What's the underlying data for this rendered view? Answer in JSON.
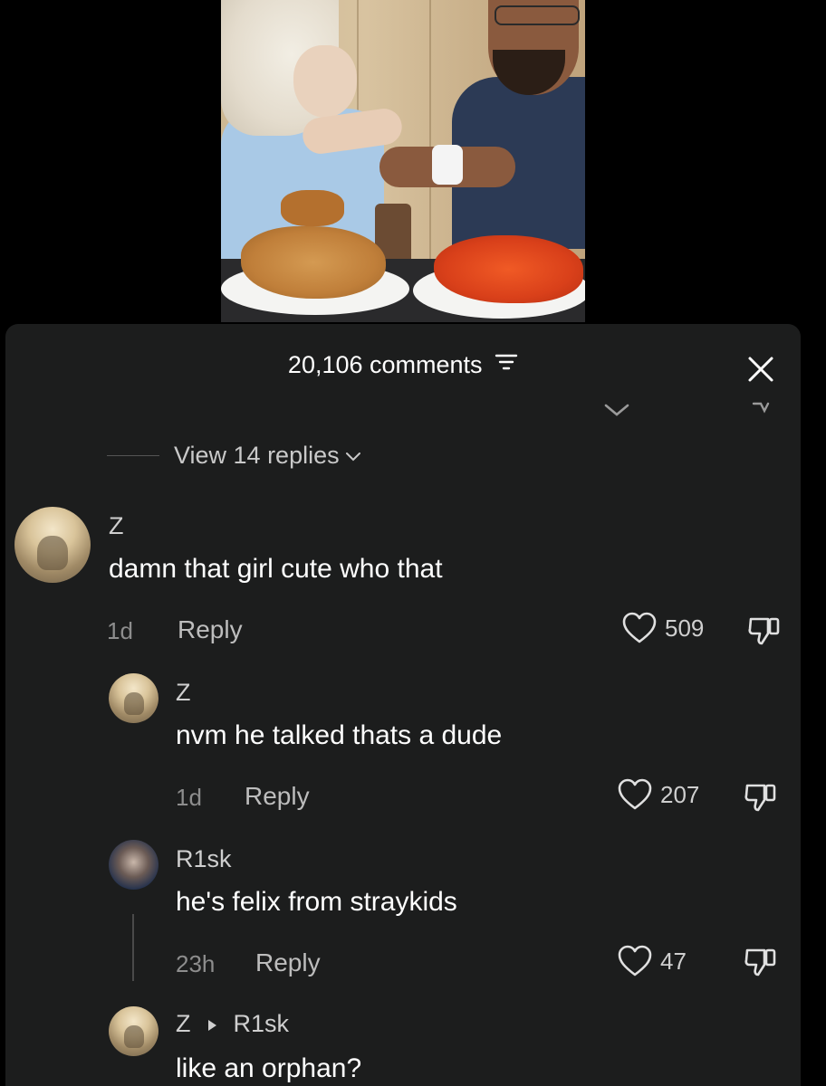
{
  "header": {
    "title": "20,106 comments"
  },
  "view_replies": {
    "label": "View 14 replies"
  },
  "comments": [
    {
      "user": "Z",
      "text": "damn that girl cute who that",
      "time": "1d",
      "reply_label": "Reply",
      "likes": "509"
    },
    {
      "user": "Z",
      "text": "nvm he talked thats a dude",
      "time": "1d",
      "reply_label": "Reply",
      "likes": "207"
    },
    {
      "user": "R1sk",
      "text": "he's felix from straykids",
      "time": "23h",
      "reply_label": "Reply",
      "likes": "47"
    },
    {
      "user": "Z",
      "reply_to": "R1sk",
      "text": "like an orphan?"
    }
  ],
  "icons": {
    "filter": "filter-icon",
    "close": "close-icon",
    "chevron": "chevron-down-icon",
    "heart": "heart-icon",
    "dislike": "thumbs-down-icon",
    "reply_arrow": "caret-right-icon"
  },
  "colors": {
    "sheet_background": "#1c1d1d",
    "text_primary": "#ffffff",
    "text_secondary": "#8d8d8d"
  }
}
